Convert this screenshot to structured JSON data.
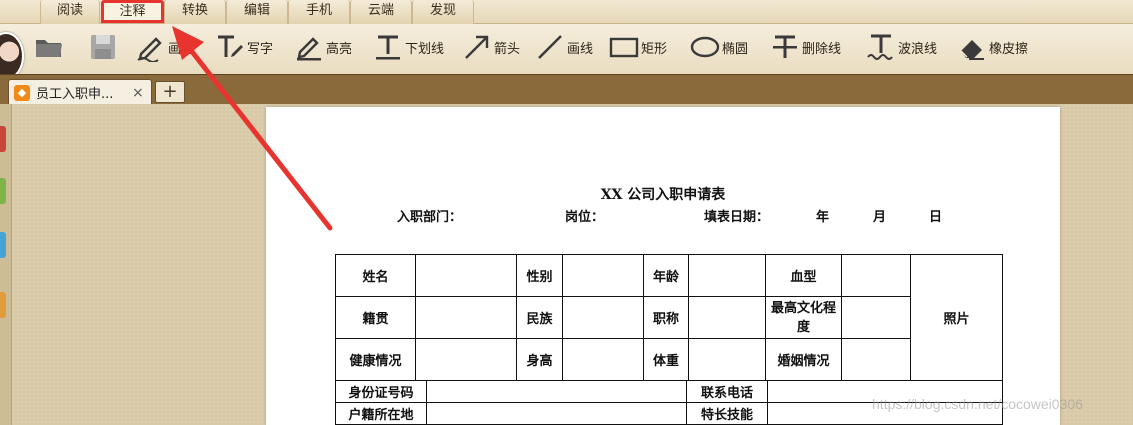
{
  "menu_tabs": [
    {
      "label": "阅读"
    },
    {
      "label": "注释",
      "active": true
    },
    {
      "label": "转换"
    },
    {
      "label": "编辑"
    },
    {
      "label": "手机"
    },
    {
      "label": "云端"
    },
    {
      "label": "发现"
    }
  ],
  "toolbar": {
    "tools": [
      {
        "icon": "open-folder-icon",
        "label": ""
      },
      {
        "icon": "save-icon",
        "label": ""
      },
      {
        "icon": "draw-pencil-icon",
        "label": "画笔"
      },
      {
        "icon": "write-text-icon",
        "label": "写字"
      },
      {
        "icon": "highlight-icon",
        "label": "高亮"
      },
      {
        "icon": "underline-icon",
        "label": "下划线"
      },
      {
        "icon": "arrow-icon",
        "label": "箭头"
      },
      {
        "icon": "line-icon",
        "label": "画线"
      },
      {
        "icon": "rectangle-icon",
        "label": "矩形"
      },
      {
        "icon": "ellipse-icon",
        "label": "椭圆"
      },
      {
        "icon": "strikethrough-icon",
        "label": "删除线"
      },
      {
        "icon": "wavy-line-icon",
        "label": "波浪线"
      },
      {
        "icon": "eraser-icon",
        "label": "橡皮擦"
      }
    ]
  },
  "document_tab": {
    "title": "员工入职申...",
    "close": "×",
    "add": "+"
  },
  "document": {
    "title": "XX 公司入职申请表",
    "meta": {
      "department": "入职部门：",
      "position": "岗位：",
      "fill_date": "填表日期：",
      "year": "年",
      "month": "月",
      "day": "日"
    },
    "table": {
      "row1": [
        "姓名",
        "性别",
        "年龄",
        "血型"
      ],
      "row2": [
        "籍贯",
        "民族",
        "职称",
        "最高文化程度"
      ],
      "row3": [
        "健康情况",
        "身高",
        "体重",
        "婚姻情况"
      ],
      "photo": "照片",
      "row4": [
        "身份证号码",
        "联系电话"
      ],
      "row5": [
        "户籍所在地",
        "特长技能"
      ]
    }
  },
  "watermark": "https://blog.csdn.net/cocowei0306",
  "colors": {
    "annotation_red": "#e8342f",
    "toolbar_bg": "#efe4cc",
    "tabbar_bg": "#8a6a3a"
  }
}
